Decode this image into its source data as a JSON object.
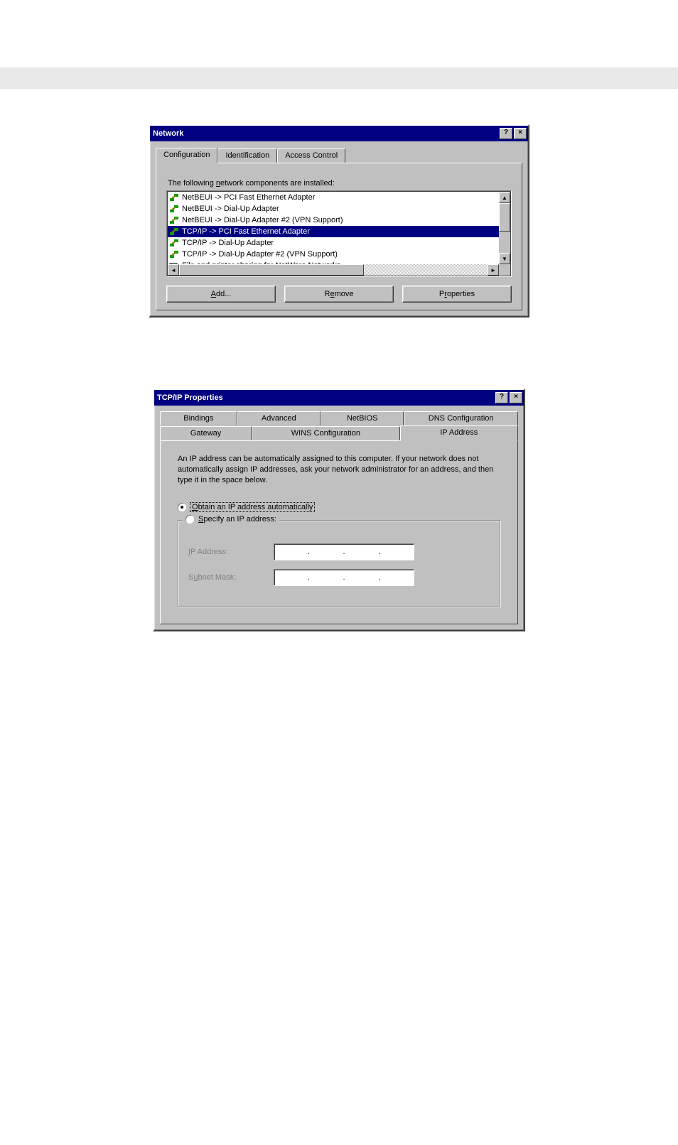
{
  "network_dialog": {
    "title": "Network",
    "tabs": [
      "Configuration",
      "Identification",
      "Access Control"
    ],
    "active_tab_index": 0,
    "list_label_pre": "The following ",
    "list_label_accel": "n",
    "list_label_post": "etwork components are installed:",
    "items": [
      {
        "icon": "protocol",
        "text": "NetBEUI -> PCI Fast Ethernet Adapter",
        "selected": false
      },
      {
        "icon": "protocol",
        "text": "NetBEUI -> Dial-Up Adapter",
        "selected": false
      },
      {
        "icon": "protocol",
        "text": "NetBEUI -> Dial-Up Adapter #2 (VPN Support)",
        "selected": false
      },
      {
        "icon": "protocol",
        "text": "TCP/IP -> PCI Fast Ethernet Adapter",
        "selected": true
      },
      {
        "icon": "protocol",
        "text": "TCP/IP -> Dial-Up Adapter",
        "selected": false
      },
      {
        "icon": "protocol",
        "text": "TCP/IP -> Dial-Up Adapter #2 (VPN Support)",
        "selected": false
      },
      {
        "icon": "service",
        "text": "File and printer sharing for NetWare Networks",
        "selected": false
      }
    ],
    "buttons": {
      "add_pre": "",
      "add_accel": "A",
      "add_post": "dd...",
      "remove_pre": "R",
      "remove_accel": "e",
      "remove_post": "move",
      "properties_pre": "P",
      "properties_accel": "r",
      "properties_post": "operties"
    }
  },
  "tcpip_dialog": {
    "title": "TCP/IP Properties",
    "tabs_row1": [
      "Bindings",
      "Advanced",
      "NetBIOS",
      "DNS Configuration"
    ],
    "tabs_row2": [
      "Gateway",
      "WINS Configuration",
      "IP Address"
    ],
    "active_tab": "IP Address",
    "description": "An IP address can be automatically assigned to this computer.  If your network does not automatically assign IP addresses, ask your network administrator for an address, and then type it in the space below.",
    "radio_auto_accel": "O",
    "radio_auto_post": "btain an IP address automatically",
    "radio_specify_accel": "S",
    "radio_specify_post": "pecify an IP address:",
    "auto_selected": true,
    "ip_label_accel": "I",
    "ip_label_post": "P Address:",
    "subnet_label_pre": "S",
    "subnet_label_accel": "u",
    "subnet_label_post": "bnet Mask:"
  }
}
